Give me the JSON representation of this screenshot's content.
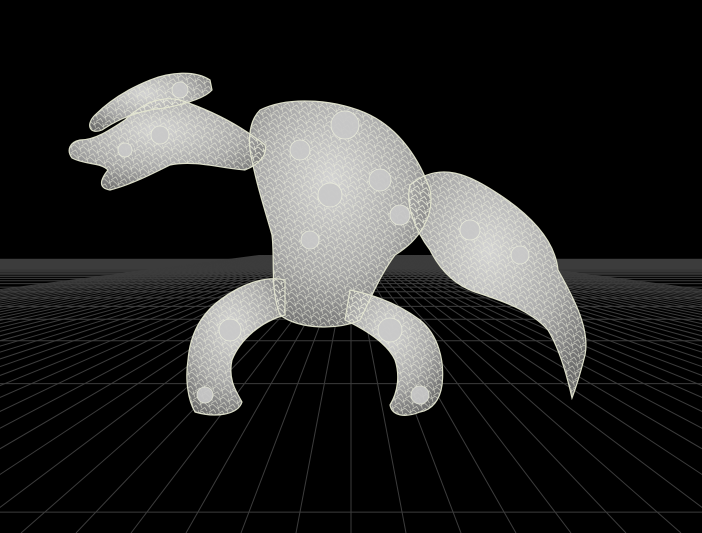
{
  "viewport": {
    "background": "#000000",
    "grid_color": "#3c3c3c",
    "grid_visible": true
  },
  "model": {
    "shading_color": "#b8b8b8",
    "wireframe_color": "#e9ead6",
    "shadow_color": "#7c7c7c"
  }
}
